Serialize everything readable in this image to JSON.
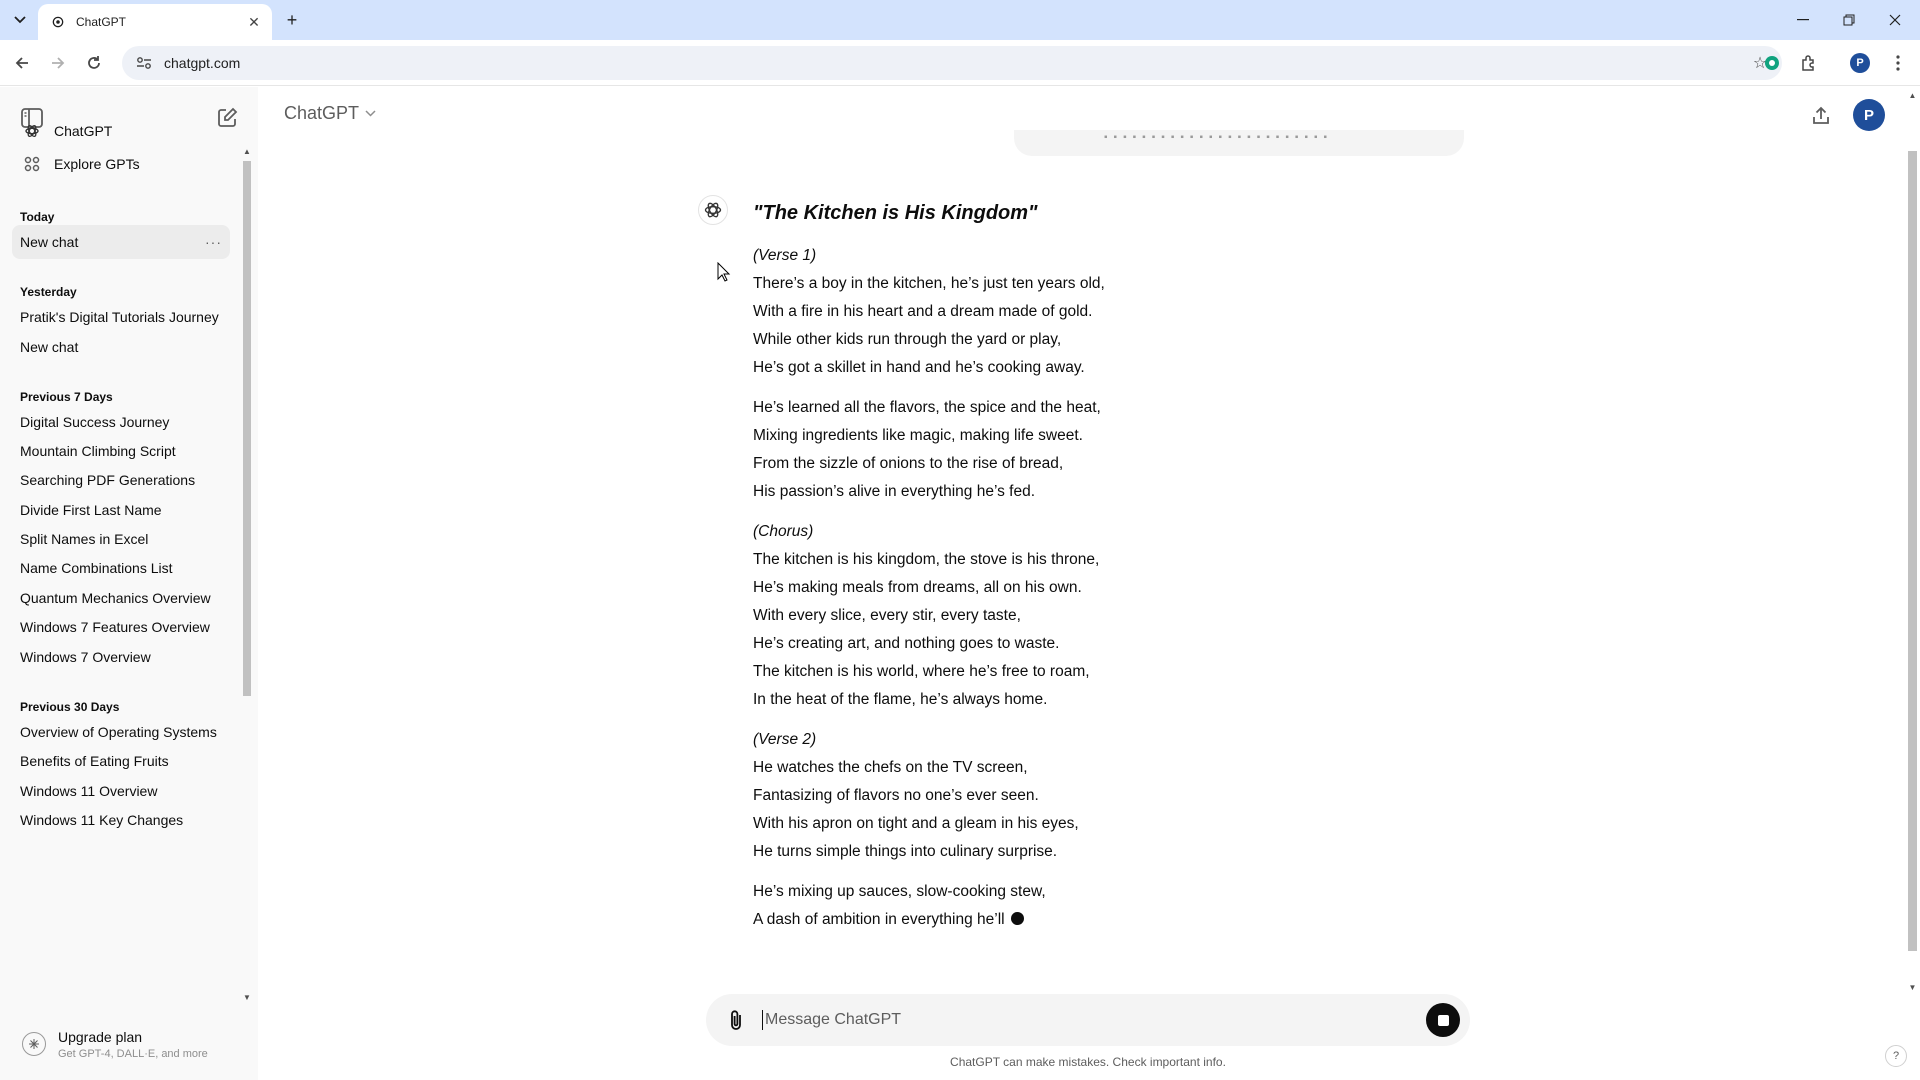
{
  "browser": {
    "tab_title": "ChatGPT",
    "url": "chatgpt.com",
    "profile_initial": "P"
  },
  "app": {
    "model_name": "ChatGPT",
    "avatar_initial": "P"
  },
  "sidebar": {
    "links": [
      {
        "label": "ChatGPT",
        "icon": "chatgpt-logo-icon"
      },
      {
        "label": "Explore GPTs",
        "icon": "grid-icon"
      }
    ],
    "sections": [
      {
        "title": "Today",
        "items": [
          "New chat"
        ]
      },
      {
        "title": "Yesterday",
        "items": [
          "Pratik's Digital Tutorials Journey",
          "New chat"
        ]
      },
      {
        "title": "Previous 7 Days",
        "items": [
          "Digital Success Journey",
          "Mountain Climbing Script",
          "Searching PDF Generations",
          "Divide First Last Name",
          "Split Names in Excel",
          "Name Combinations List",
          "Quantum Mechanics Overview",
          "Windows 7 Features Overview",
          "Windows 7 Overview"
        ]
      },
      {
        "title": "Previous 30 Days",
        "items": [
          "Overview of Operating Systems",
          "Benefits of Eating Fruits",
          "Windows 11 Overview",
          "Windows 11 Key Changes"
        ]
      }
    ],
    "more_glyph": "···",
    "upgrade": {
      "title": "Upgrade plan",
      "subtitle": "Get GPT-4, DALL·E, and more"
    }
  },
  "response": {
    "title": "\"The Kitchen is His Kingdom\"",
    "stanzas": [
      {
        "label": "(Verse 1)",
        "lines": [
          "There’s a boy in the kitchen, he’s just ten years old,",
          "With a fire in his heart and a dream made of gold.",
          "While other kids run through the yard or play,",
          "He’s got a skillet in hand and he’s cooking away."
        ]
      },
      {
        "label": "",
        "lines": [
          "He’s learned all the flavors, the spice and the heat,",
          "Mixing ingredients like magic, making life sweet.",
          "From the sizzle of onions to the rise of bread,",
          "His passion’s alive in everything he’s fed."
        ]
      },
      {
        "label": "(Chorus)",
        "lines": [
          "The kitchen is his kingdom, the stove is his throne,",
          "He’s making meals from dreams, all on his own.",
          "With every slice, every stir, every taste,",
          "He’s creating art, and nothing goes to waste.",
          "The kitchen is his world, where he’s free to roam,",
          "In the heat of the flame, he’s always home."
        ]
      },
      {
        "label": "(Verse 2)",
        "lines": [
          "He watches the chefs on the TV screen,",
          "Fantasizing of flavors no one’s ever seen.",
          "With his apron on tight and a gleam in his eyes,",
          "He turns simple things into culinary surprise."
        ]
      },
      {
        "label": "",
        "lines": [
          "He’s mixing up sauces, slow-cooking stew,",
          "A dash of ambition in everything he’ll"
        ]
      }
    ]
  },
  "composer": {
    "placeholder": "Message ChatGPT",
    "disclaimer": "ChatGPT can make mistakes. Check important info."
  },
  "help_label": "?"
}
